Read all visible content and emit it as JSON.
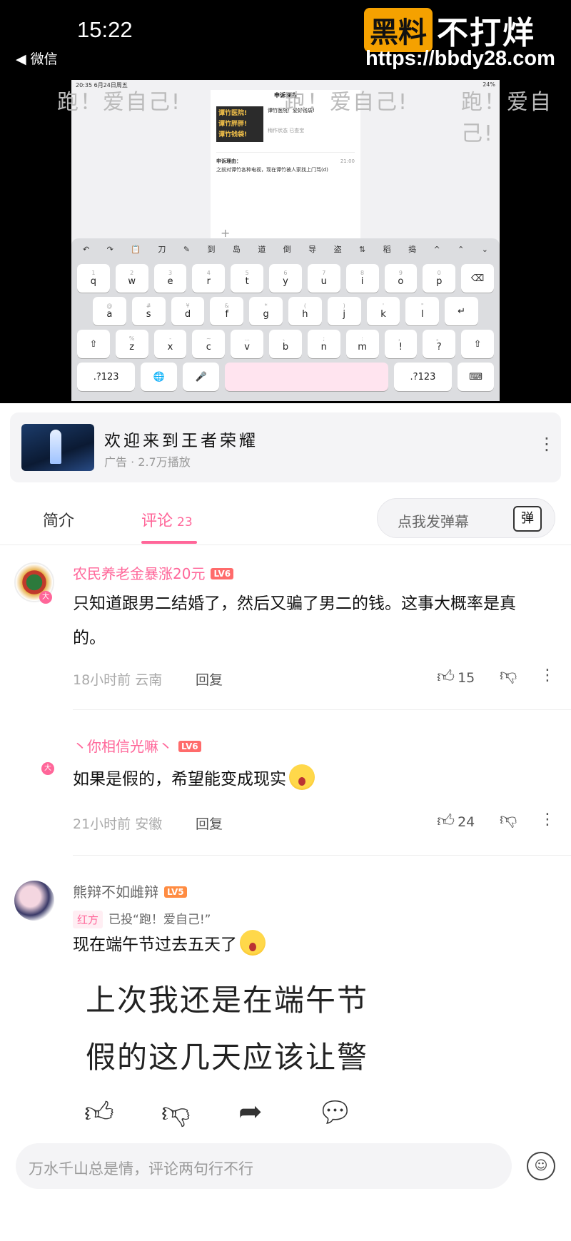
{
  "status": {
    "time": "15:22",
    "back_label": "◀ 微信"
  },
  "watermark": {
    "brand_box": "黑料",
    "brand_rest": "不打烊",
    "url": "https://bbdy28.com"
  },
  "video": {
    "banner": "跑！爱自己!",
    "tablet": {
      "status": "20:35  6月24日周五",
      "battery": "24%",
      "chat_title": "申诉理由",
      "card_thumb": [
        "谭竹医院!",
        "谭竹胖胖!",
        "谭竹钱袋!"
      ],
      "card_title": "谭竹医院！爱好钱袋!",
      "card_meta": "稍作状态  已查宝",
      "msg_header": "申诉理由：",
      "msg_time": "21:00",
      "msg_text": "之前对谭竹各种电视，现在谭竹被人家找上门骂(d)",
      "plus": "+"
    },
    "keyboard": {
      "toolbar": [
        "↶",
        "↷",
        "📋",
        "刀",
        "✎",
        "到",
        "岛",
        "道",
        "倒",
        "导",
        "盗",
        "⇅",
        "稻",
        "捣",
        "^",
        "⌃",
        "⌄"
      ],
      "row1": [
        "q",
        "w",
        "e",
        "r",
        "t",
        "y",
        "u",
        "i",
        "o",
        "p",
        "⌫"
      ],
      "row1_hints": [
        "1",
        "2",
        "3",
        "4",
        "5",
        "6",
        "7",
        "8",
        "9",
        "0",
        ""
      ],
      "row2": [
        "a",
        "s",
        "d",
        "f",
        "g",
        "h",
        "j",
        "k",
        "l",
        "↵"
      ],
      "row2_hints": [
        "@",
        "#",
        "¥",
        "&",
        "*",
        "(",
        ")",
        "'",
        "\"",
        ""
      ],
      "row3": [
        "⇧",
        "z",
        "x",
        "c",
        "v",
        "b",
        "n",
        "m",
        "!",
        "?",
        "⇧"
      ],
      "row3_hints": [
        "",
        "%",
        "-",
        "~",
        "...",
        "、",
        ";",
        ":",
        "，",
        "。",
        ""
      ],
      "row4": [
        ".?123",
        "🌐",
        "🎤",
        "",
        ".?123",
        "⌨"
      ]
    }
  },
  "ad": {
    "title": "欢迎来到王者荣耀",
    "subtitle": "广告 · 2.7万播放",
    "more_icon": "⋮"
  },
  "tabs": {
    "intro": "简介",
    "comments": "评论",
    "comments_count": "23",
    "danmaku_placeholder": "点我发弹幕",
    "danmaku_icon": "弹"
  },
  "comments": [
    {
      "user": "农民养老金暴涨20元",
      "level": "LV6",
      "avatar_badge": "大",
      "text": "只知道跟男二结婚了，然后又骗了男二的钱。这事大概率是真的。",
      "time_loc": "18小时前 云南",
      "reply": "回复",
      "likes": "15"
    },
    {
      "user": "丶你相信光嘛丶",
      "level": "LV6",
      "avatar_badge": "大",
      "text": "如果是假的，希望能变成现实",
      "time_loc": "21小时前 安徽",
      "reply": "回复",
      "likes": "24"
    },
    {
      "user": "熊辩不如雌辩",
      "level": "LV5",
      "vote_tag": "红方",
      "vote_text": "已投“跑！爱自己!”",
      "text": "现在端午节过去五天了"
    }
  ],
  "zoomed_text": {
    "line1": "上次我还是在端午节",
    "line2": "假的这几天应该让警"
  },
  "icons": {
    "like": "thumbs-up-icon",
    "dislike": "thumbs-down-icon",
    "share": "share-icon",
    "comment": "comment-icon",
    "more": "more-icon",
    "emoji": "emoji-icon"
  },
  "input": {
    "placeholder": "万水千山总是情，评论两句行不行"
  },
  "colors": {
    "accent": "#ff6699",
    "brand_orange": "#f5a100"
  }
}
